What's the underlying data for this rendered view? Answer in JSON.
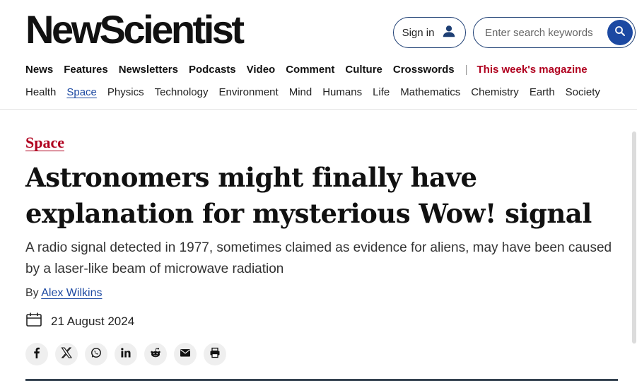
{
  "header": {
    "logo": "NewScientist",
    "signin_label": "Sign in",
    "search_placeholder": "Enter search keywords"
  },
  "nav_primary": {
    "items": [
      "News",
      "Features",
      "Newsletters",
      "Podcasts",
      "Video",
      "Comment",
      "Culture",
      "Crosswords"
    ],
    "magazine_label": "This week's magazine",
    "separator": "|"
  },
  "nav_topics": {
    "items": [
      "Health",
      "Space",
      "Physics",
      "Technology",
      "Environment",
      "Mind",
      "Humans",
      "Life",
      "Mathematics",
      "Chemistry",
      "Earth",
      "Society"
    ],
    "active": "Space"
  },
  "article": {
    "section": "Space",
    "headline": "Astronomers might finally have explanation for mysterious Wow! signal",
    "standfirst": "A radio signal detected in 1977, sometimes claimed as evidence for aliens, may have been caused by a laser-like beam of microwave radiation",
    "byline_prefix": "By",
    "author": "Alex Wilkins",
    "date": "21 August 2024"
  },
  "share_icons": [
    "facebook-icon",
    "x-icon",
    "whatsapp-icon",
    "linkedin-icon",
    "reddit-icon",
    "email-icon",
    "print-icon"
  ],
  "colors": {
    "accent_blue": "#1c49a2",
    "section_red": "#b0001f",
    "text": "#111111"
  }
}
